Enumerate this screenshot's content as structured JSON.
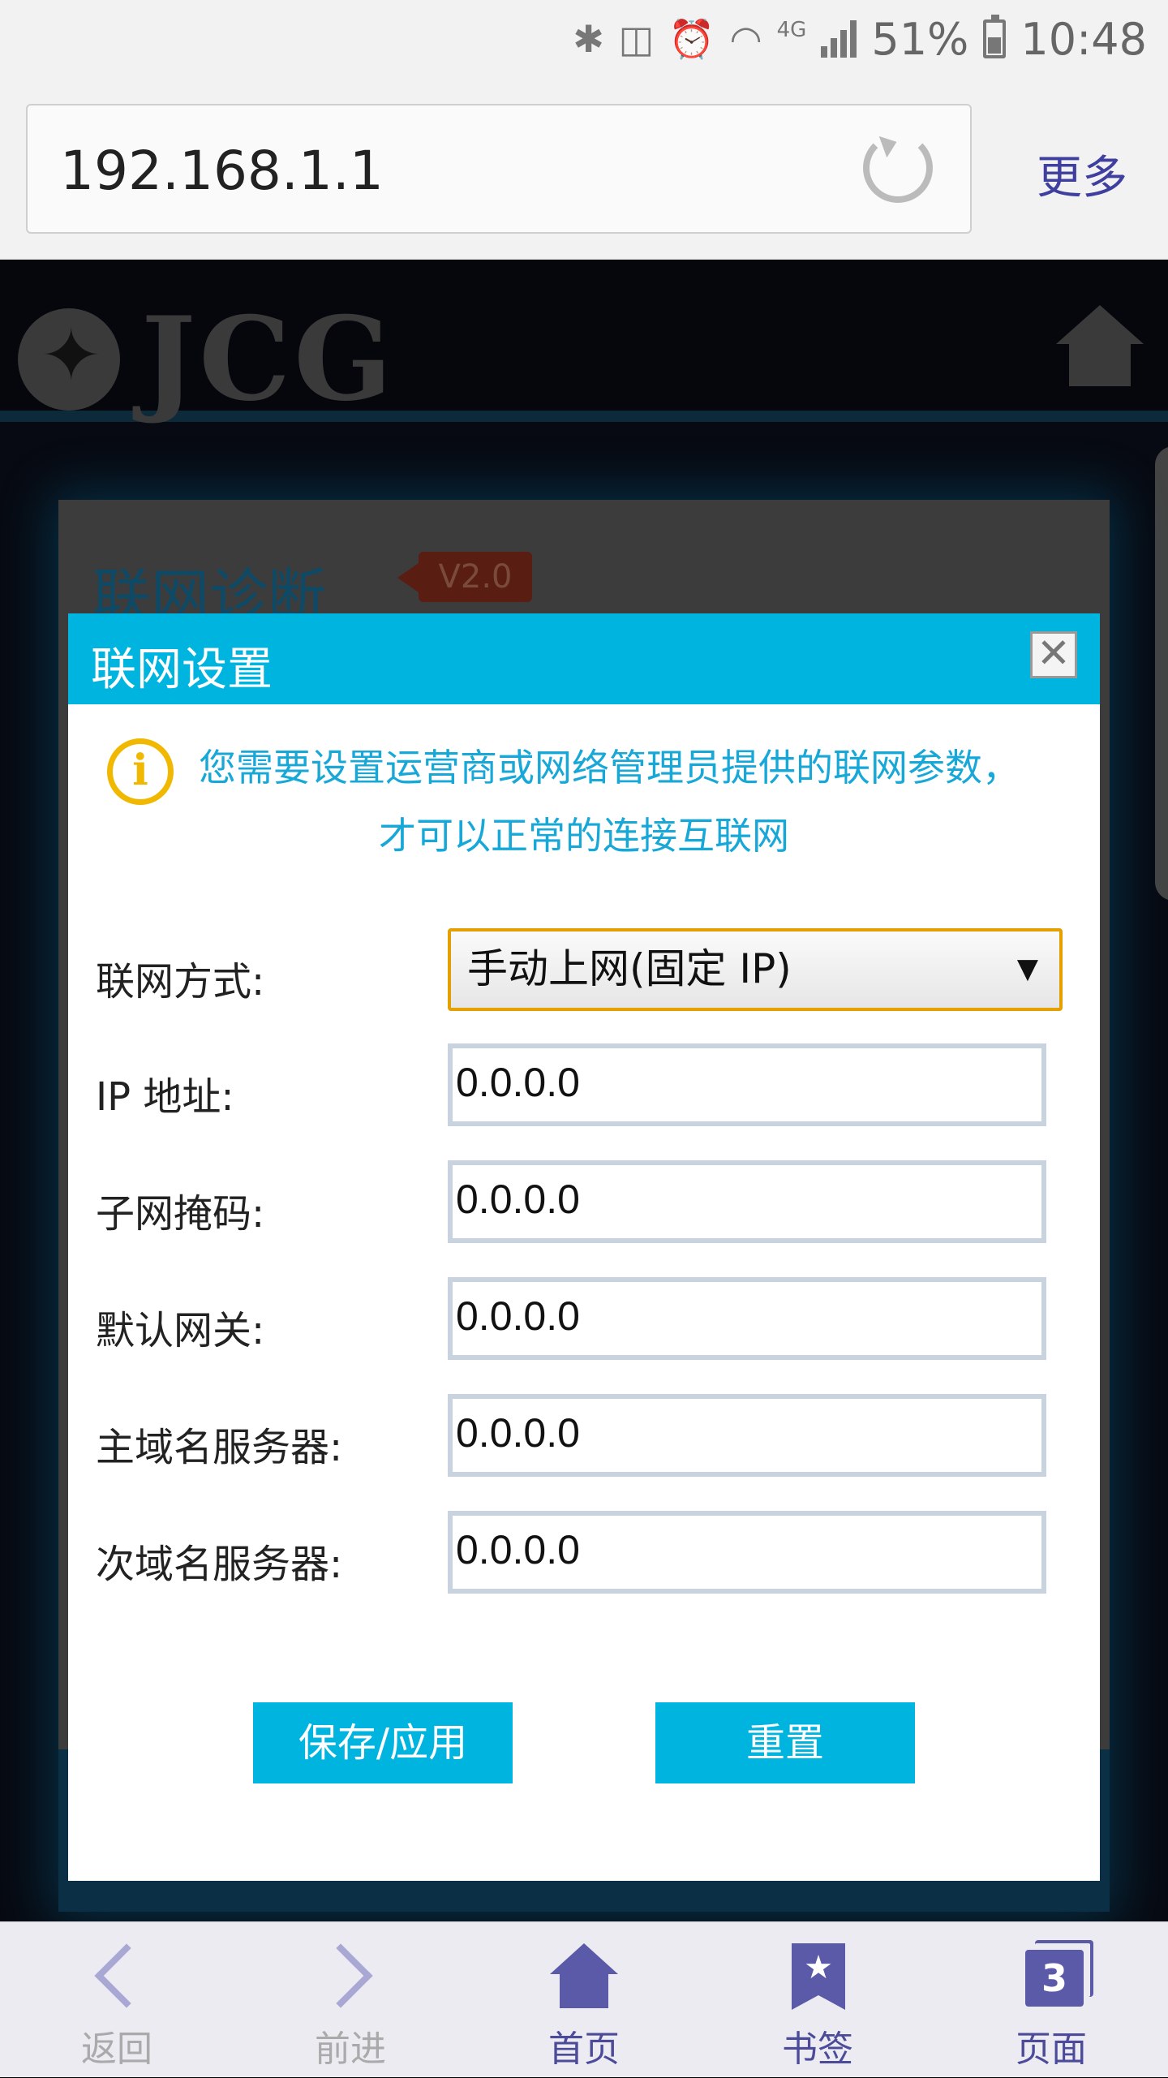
{
  "status_bar": {
    "network_type": "4G",
    "battery": "51%",
    "battery_level": 0.51,
    "time": "10:48",
    "icons": [
      "bluetooth-icon",
      "vibrate-mute-icon",
      "alarm-icon",
      "wifi-icon",
      "signal-icon",
      "battery-icon"
    ]
  },
  "browser": {
    "url": "192.168.1.1",
    "more_label": "更多"
  },
  "router_page": {
    "logo_text": "JCG",
    "panel_title": "联网诊断",
    "version": "V2.0"
  },
  "dialog": {
    "title": "联网设置",
    "close_label": "✕",
    "notice_line1": "您需要设置运营商或网络管理员提供的联网参数，",
    "notice_line2": "才可以正常的连接互联网",
    "connection_mode": {
      "label": "联网方式:",
      "value": "手动上网(固定 IP)"
    },
    "fields": [
      {
        "label": "IP 地址:",
        "value": "0.0.0.0"
      },
      {
        "label": "子网掩码:",
        "value": "0.0.0.0"
      },
      {
        "label": "默认网关:",
        "value": "0.0.0.0"
      },
      {
        "label": "主域名服务器:",
        "value": "0.0.0.0"
      },
      {
        "label": "次域名服务器:",
        "value": "0.0.0.0"
      }
    ],
    "save_label": "保存/应用",
    "reset_label": "重置"
  },
  "bottom_nav": {
    "back": "返回",
    "forward": "前进",
    "home": "首页",
    "bookmarks": "书签",
    "pages": "页面",
    "pages_count": "3"
  },
  "colors": {
    "accent": "#00b4e0",
    "notice_text": "#17a8d8",
    "info_icon": "#f0b800",
    "nav_active": "#4b4b9a"
  }
}
